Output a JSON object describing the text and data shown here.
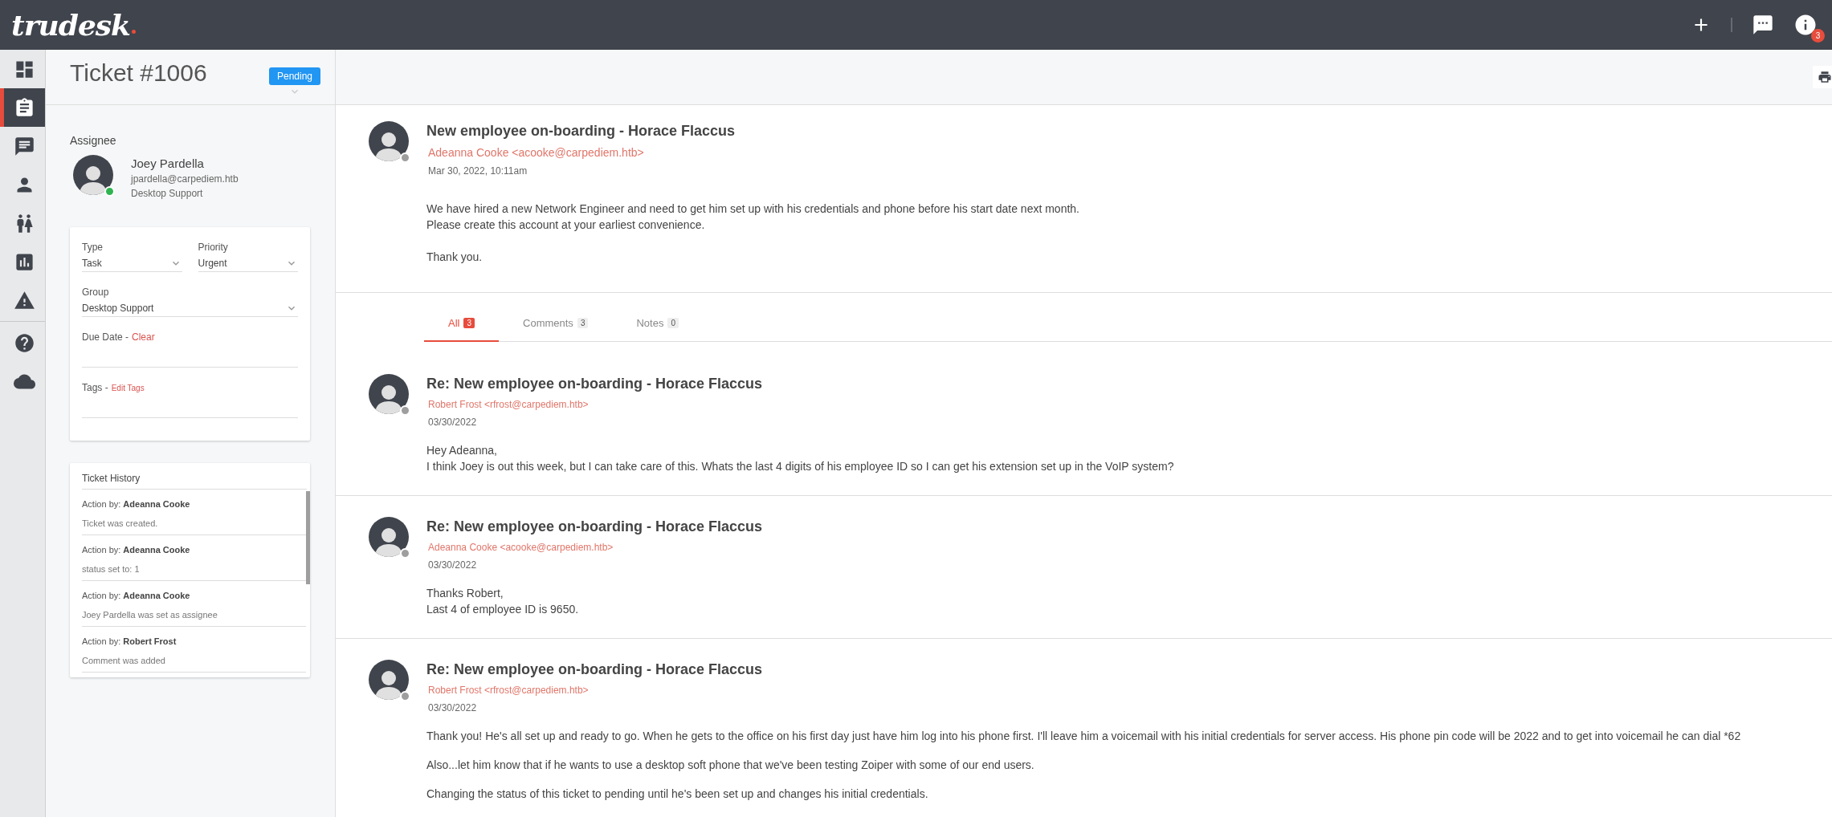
{
  "header": {
    "logo": "trudesk",
    "notification_count": "3"
  },
  "sidebar": {
    "items": [
      {
        "kind": "dashboard",
        "selected": false
      },
      {
        "kind": "tickets",
        "selected": true
      },
      {
        "kind": "messages",
        "selected": false
      },
      {
        "kind": "user",
        "selected": false
      },
      {
        "kind": "groups",
        "selected": false
      },
      {
        "kind": "reports",
        "selected": false
      },
      {
        "kind": "notices",
        "selected": false
      }
    ],
    "bottom_items": [
      {
        "kind": "help",
        "selected": false
      },
      {
        "kind": "cloud",
        "selected": false
      }
    ]
  },
  "ticket": {
    "title": "Ticket #1006",
    "status": "Pending"
  },
  "assignee": {
    "label": "Assignee",
    "name": "Joey Pardella",
    "email": "jpardella@carpediem.htb",
    "group": "Desktop Support",
    "online": true
  },
  "properties": {
    "type": {
      "label": "Type",
      "value": "Task"
    },
    "priority": {
      "label": "Priority",
      "value": "Urgent"
    },
    "group": {
      "label": "Group",
      "value": "Desktop Support"
    },
    "due_date": {
      "label": "Due Date -",
      "action": "Clear"
    },
    "tags": {
      "label": "Tags -",
      "action": "Edit Tags"
    }
  },
  "history": {
    "title": "Ticket History",
    "entries": [
      {
        "action": "Action by: **Adeanna Cooke**",
        "description": "Ticket was created."
      },
      {
        "action": "Action by: **Adeanna Cooke**",
        "description": "status set to: 1"
      },
      {
        "action": "Action by: **Adeanna Cooke**",
        "description": "Joey Pardella was set as assignee"
      },
      {
        "action": "Action by: **Robert Frost**",
        "description": "Comment was added"
      }
    ]
  },
  "message": {
    "title": "New employee on-boarding - Horace Flaccus",
    "author": "Adeanna Cooke <acooke@carpediem.htb>",
    "online": false,
    "date": "Mar 30, 2022, 10:11am",
    "paragraphs": [
      [
        "We have hired a new Network Engineer and need to get him set up with his credentials and phone before his start date next month.",
        "Please create this account at your earliest convenience."
      ],
      [
        "Thank you."
      ]
    ]
  },
  "tabs": [
    {
      "label": "All",
      "count": "3",
      "selected": true
    },
    {
      "label": "Comments",
      "count": "3",
      "selected": false
    },
    {
      "label": "Notes",
      "count": "0",
      "selected": false
    }
  ],
  "replies": [
    {
      "title": "Re: New employee on-boarding - Horace Flaccus",
      "author": "Robert Frost <rfrost@carpediem.htb>",
      "online": false,
      "date": "03/30/2022",
      "paragraphs": [
        [
          "Hey Adeanna,",
          "I think Joey is out this week, but I can take care of this. Whats the last 4 digits of his employee ID so I can get his extension set up in the VoIP system?"
        ]
      ]
    },
    {
      "title": "Re: New employee on-boarding - Horace Flaccus",
      "author": "Adeanna Cooke <acooke@carpediem.htb>",
      "online": false,
      "date": "03/30/2022",
      "paragraphs": [
        [
          "Thanks Robert,",
          "Last 4 of employee ID is 9650."
        ]
      ]
    },
    {
      "title": "Re: New employee on-boarding - Horace Flaccus",
      "author": "Robert Frost <rfrost@carpediem.htb>",
      "online": false,
      "date": "03/30/2022",
      "paragraphs": [
        [
          "Thank you! He's all set up and ready to go. When he gets to the office on his first day just have him log into his phone first. I'll leave him a voicemail with his initial credentials for server access. His phone pin code will be 2022 and to get into voicemail he can dial *62"
        ],
        [
          "Also...let him know that if he wants to use a desktop soft phone that we've been testing Zoiper with some of our end users."
        ],
        [
          "Changing the status of this ticket to pending until he's been set up and changes his initial credentials."
        ]
      ]
    }
  ]
}
